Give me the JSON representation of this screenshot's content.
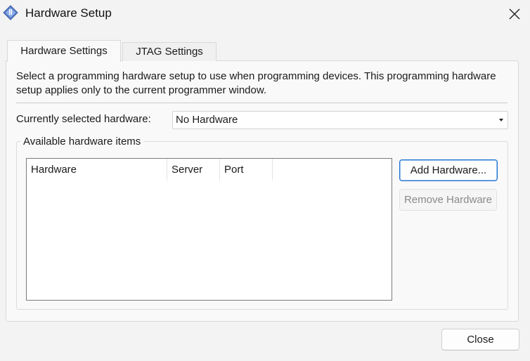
{
  "window": {
    "title": "Hardware Setup",
    "app_icon": "chip-icon",
    "close_icon": "close-icon"
  },
  "tabs": [
    {
      "label": "Hardware Settings",
      "active": true
    },
    {
      "label": "JTAG Settings",
      "active": false
    }
  ],
  "description": "Select a programming hardware setup to use when programming devices. This programming hardware setup applies only to the current programmer window.",
  "selected_hardware": {
    "label": "Currently selected hardware:",
    "value": "No Hardware"
  },
  "available": {
    "group_title": "Available hardware items",
    "columns": [
      "Hardware",
      "Server",
      "Port"
    ],
    "rows": []
  },
  "buttons": {
    "add": "Add Hardware...",
    "remove": "Remove Hardware",
    "remove_enabled": false,
    "close": "Close"
  },
  "colors": {
    "accent_border": "#1e6fd0",
    "disabled_text": "#8a8a8a"
  }
}
